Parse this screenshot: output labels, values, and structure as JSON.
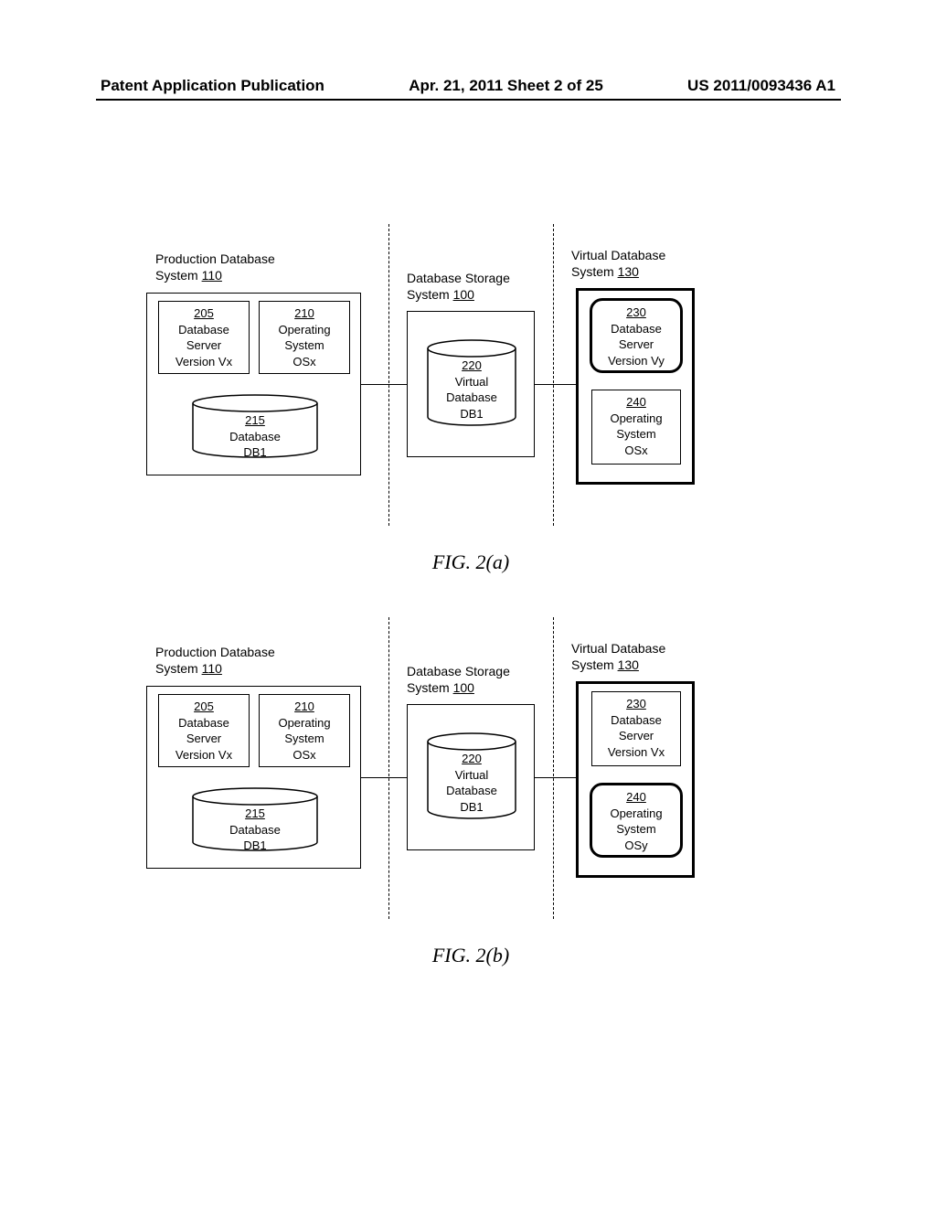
{
  "header": {
    "left": "Patent Application Publication",
    "center": "Apr. 21, 2011  Sheet 2 of 25",
    "right": "US 2011/0093436 A1"
  },
  "labels": {
    "prod_sys": "Production Database",
    "prod_sys2": "System ",
    "prod_sys_ref": "110",
    "stor_sys": "Database Storage",
    "stor_sys2": "System ",
    "stor_sys_ref": "100",
    "virt_sys": "Virtual Database",
    "virt_sys2": "System ",
    "virt_sys_ref": "130"
  },
  "boxes": {
    "b205_ref": "205",
    "b205_l1": "Database",
    "b205_l2": "Server",
    "b205_l3": "Version Vx",
    "b210_ref": "210",
    "b210_l1": "Operating",
    "b210_l2": "System",
    "b210_l3": "OSx",
    "b215_ref": "215",
    "b215_l1": "Database",
    "b215_l2": "DB1",
    "b220_ref": "220",
    "b220_l1": "Virtual",
    "b220_l2": "Database",
    "b220_l3": "DB1",
    "b230a_ref": "230",
    "b230a_l1": "Database",
    "b230a_l2": "Server",
    "b230a_l3": "Version Vy",
    "b230b_ref": "230",
    "b230b_l1": "Database",
    "b230b_l2": "Server",
    "b230b_l3": "Version Vx",
    "b240a_ref": "240",
    "b240a_l1": "Operating",
    "b240a_l2": "System",
    "b240a_l3": "OSx",
    "b240b_ref": "240",
    "b240b_l1": "Operating",
    "b240b_l2": "System",
    "b240b_l3": "OSy"
  },
  "captions": {
    "a": "FIG. 2(a)",
    "b": "FIG. 2(b)"
  }
}
